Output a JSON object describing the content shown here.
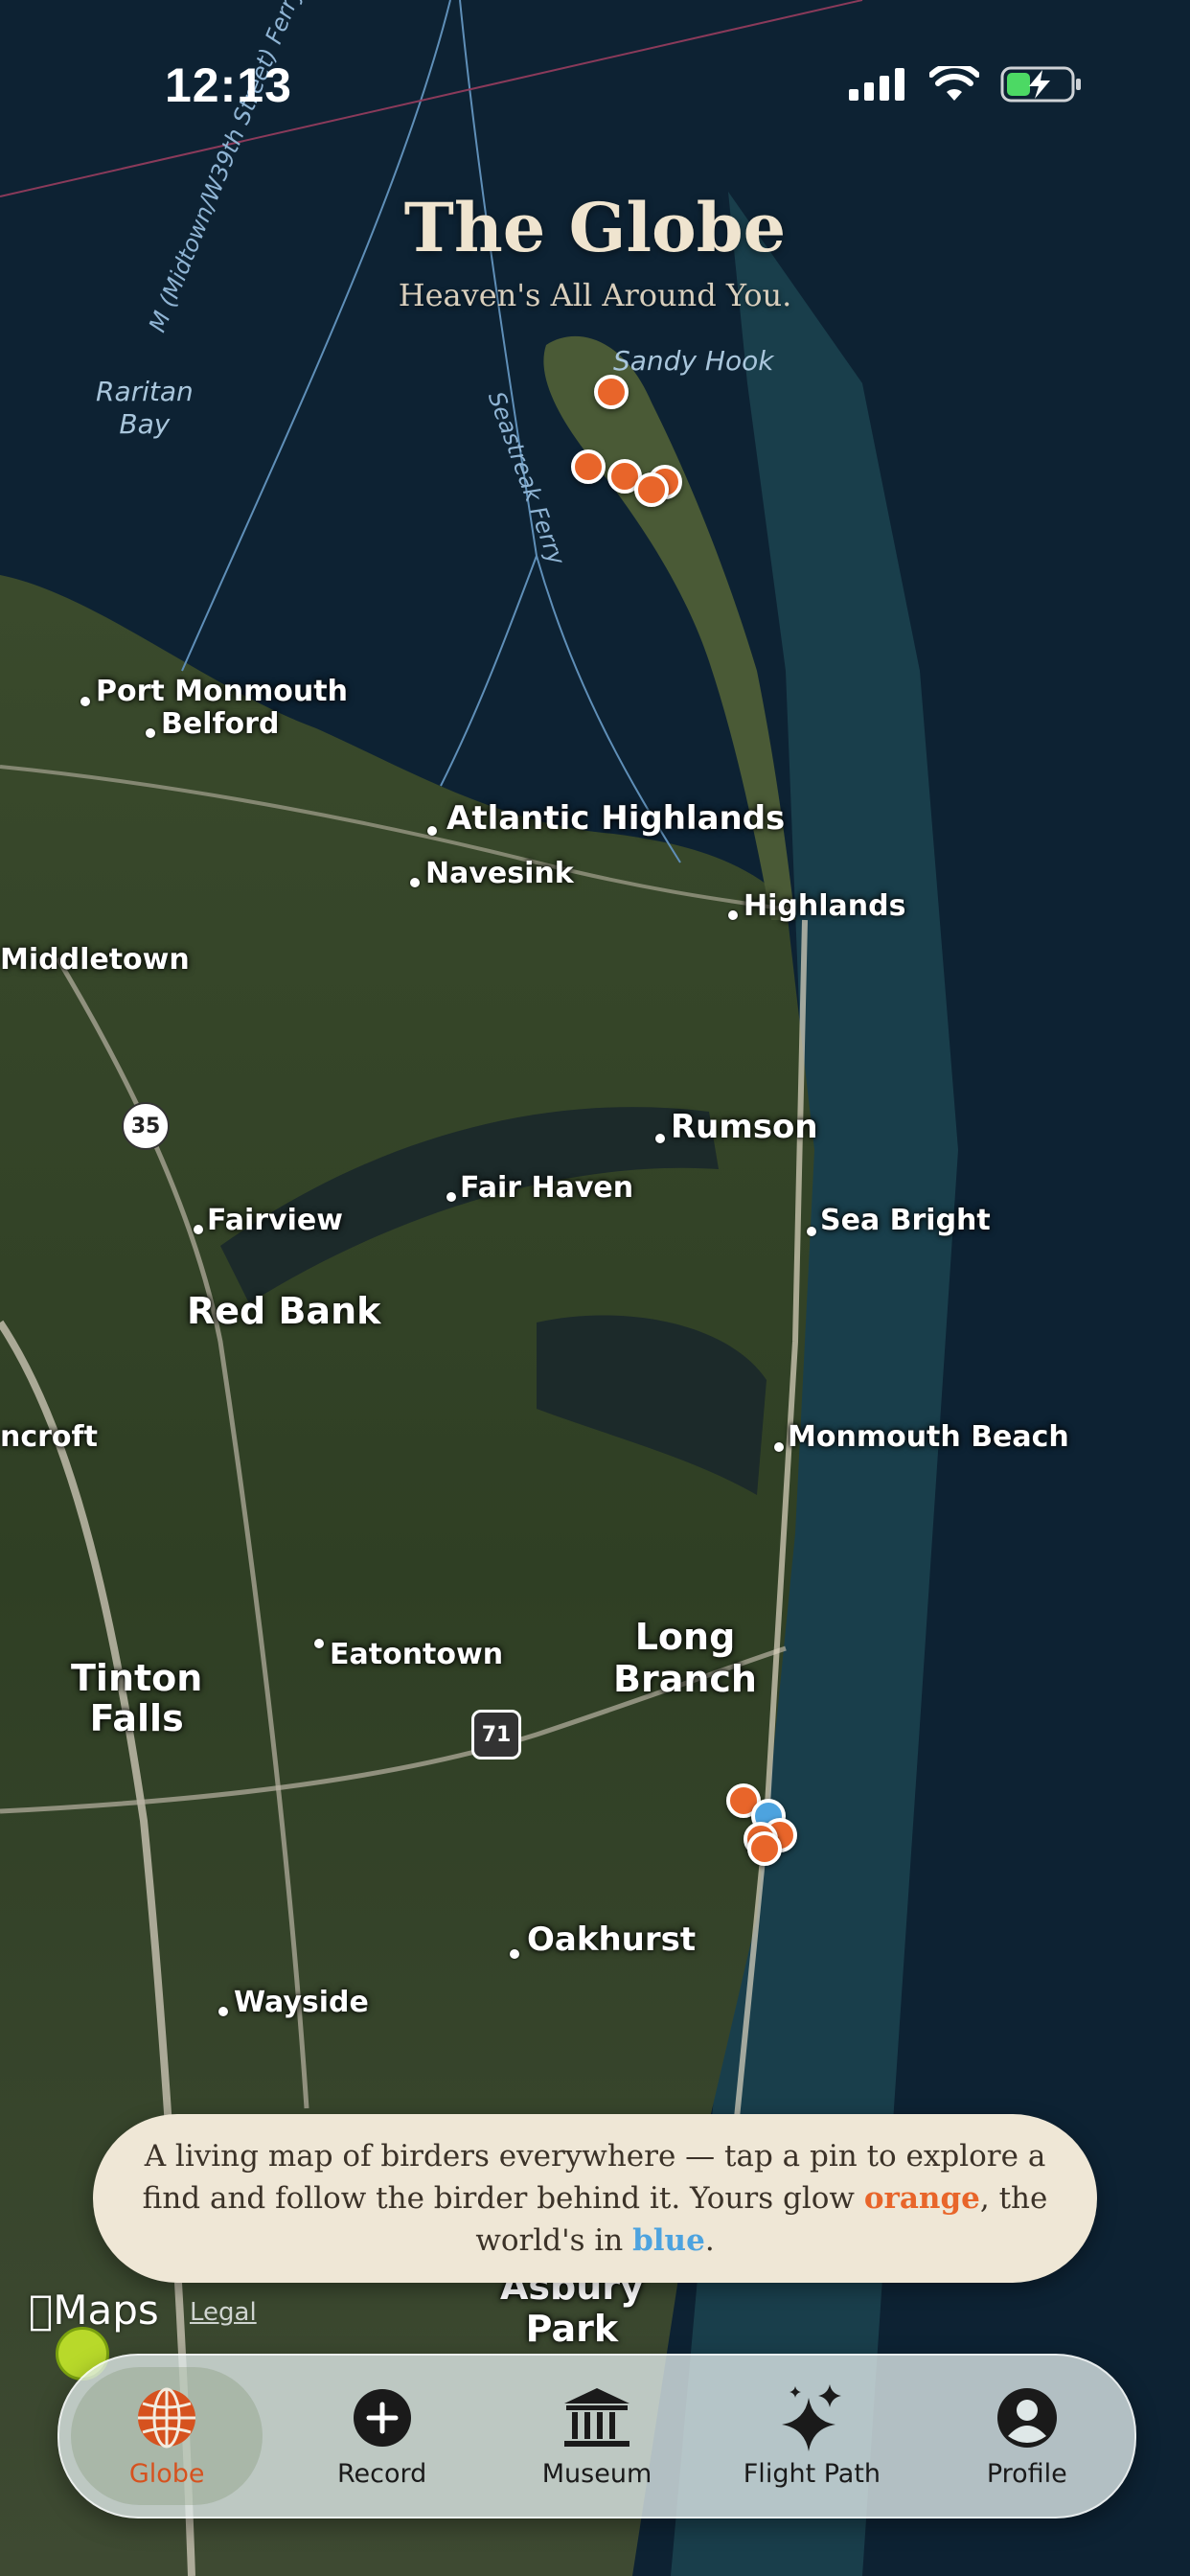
{
  "status_bar": {
    "time": "12:13"
  },
  "header": {
    "title": "The Globe",
    "subtitle": "Heaven's All Around You."
  },
  "map_labels": {
    "sandy_hook": "Sandy Hook",
    "raritan_bay": "Raritan\nBay",
    "ferry_midtown": "M (Midtown/W39th Street) Ferry",
    "seastreak_ferry": "Seastreak Ferry",
    "port_monmouth": "Port Monmouth",
    "belford": "Belford",
    "atlantic_highlands": "Atlantic Highlands",
    "navesink": "Navesink",
    "highlands": "Highlands",
    "middletown": "Middletown",
    "rumson": "Rumson",
    "fair_haven": "Fair Haven",
    "fairview": "Fairview",
    "sea_bright": "Sea Bright",
    "red_bank": "Red Bank",
    "lincroft": "ncroft",
    "monmouth_beach": "Monmouth Beach",
    "eatontown": "Eatontown",
    "long_branch": "Long\nBranch",
    "tinton_falls": "Tinton\nFalls",
    "oakhurst": "Oakhurst",
    "wayside": "Wayside",
    "asbury_park": "Asbury\nPark",
    "route_35": "35",
    "route_71": "71"
  },
  "info_card": {
    "text_before": "A living map of birders everywhere — tap a pin to explore a find and follow the birder behind it. Yours glow ",
    "orange_word": "orange",
    "text_middle": ", the world's in ",
    "blue_word": "blue",
    "text_after": "."
  },
  "map_attribution": {
    "maps": "Maps",
    "legal": "Legal"
  },
  "tabs": [
    {
      "label": "Globe",
      "icon": "globe-icon",
      "active": true
    },
    {
      "label": "Record",
      "icon": "plus-circle-icon",
      "active": false
    },
    {
      "label": "Museum",
      "icon": "museum-icon",
      "active": false
    },
    {
      "label": "Flight Path",
      "icon": "sparkles-icon",
      "active": false
    },
    {
      "label": "Profile",
      "icon": "profile-icon",
      "active": false
    }
  ],
  "colors": {
    "accent_orange": "#e8652a",
    "accent_blue": "#4da3df",
    "card_bg": "#efe7d6"
  }
}
